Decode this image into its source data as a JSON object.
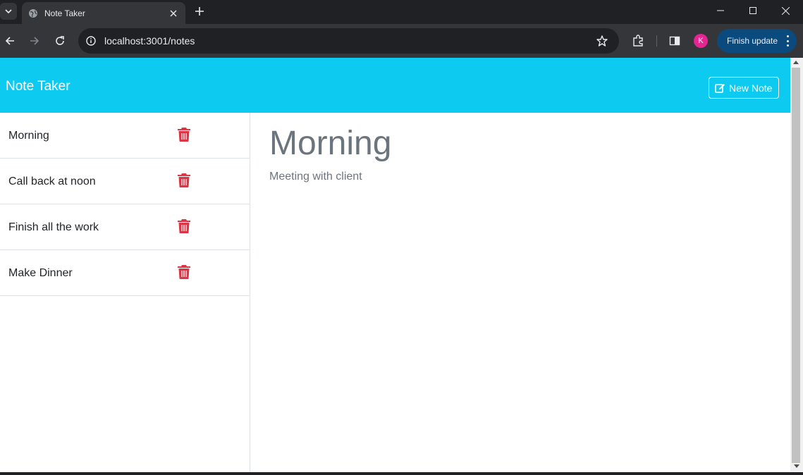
{
  "browser": {
    "tab_title": "Note Taker",
    "url": "localhost:3001/notes",
    "avatar_letter": "K",
    "update_label": "Finish update"
  },
  "app": {
    "brand": "Note Taker",
    "new_note_label": "New Note",
    "accent_color": "#0dcaf0",
    "delete_color": "#dc3545"
  },
  "notes": [
    {
      "title": "Morning"
    },
    {
      "title": "Call back at noon"
    },
    {
      "title": "Finish all the work"
    },
    {
      "title": "Make Dinner"
    }
  ],
  "active_note": {
    "title": "Morning",
    "text": "Meeting with client"
  }
}
